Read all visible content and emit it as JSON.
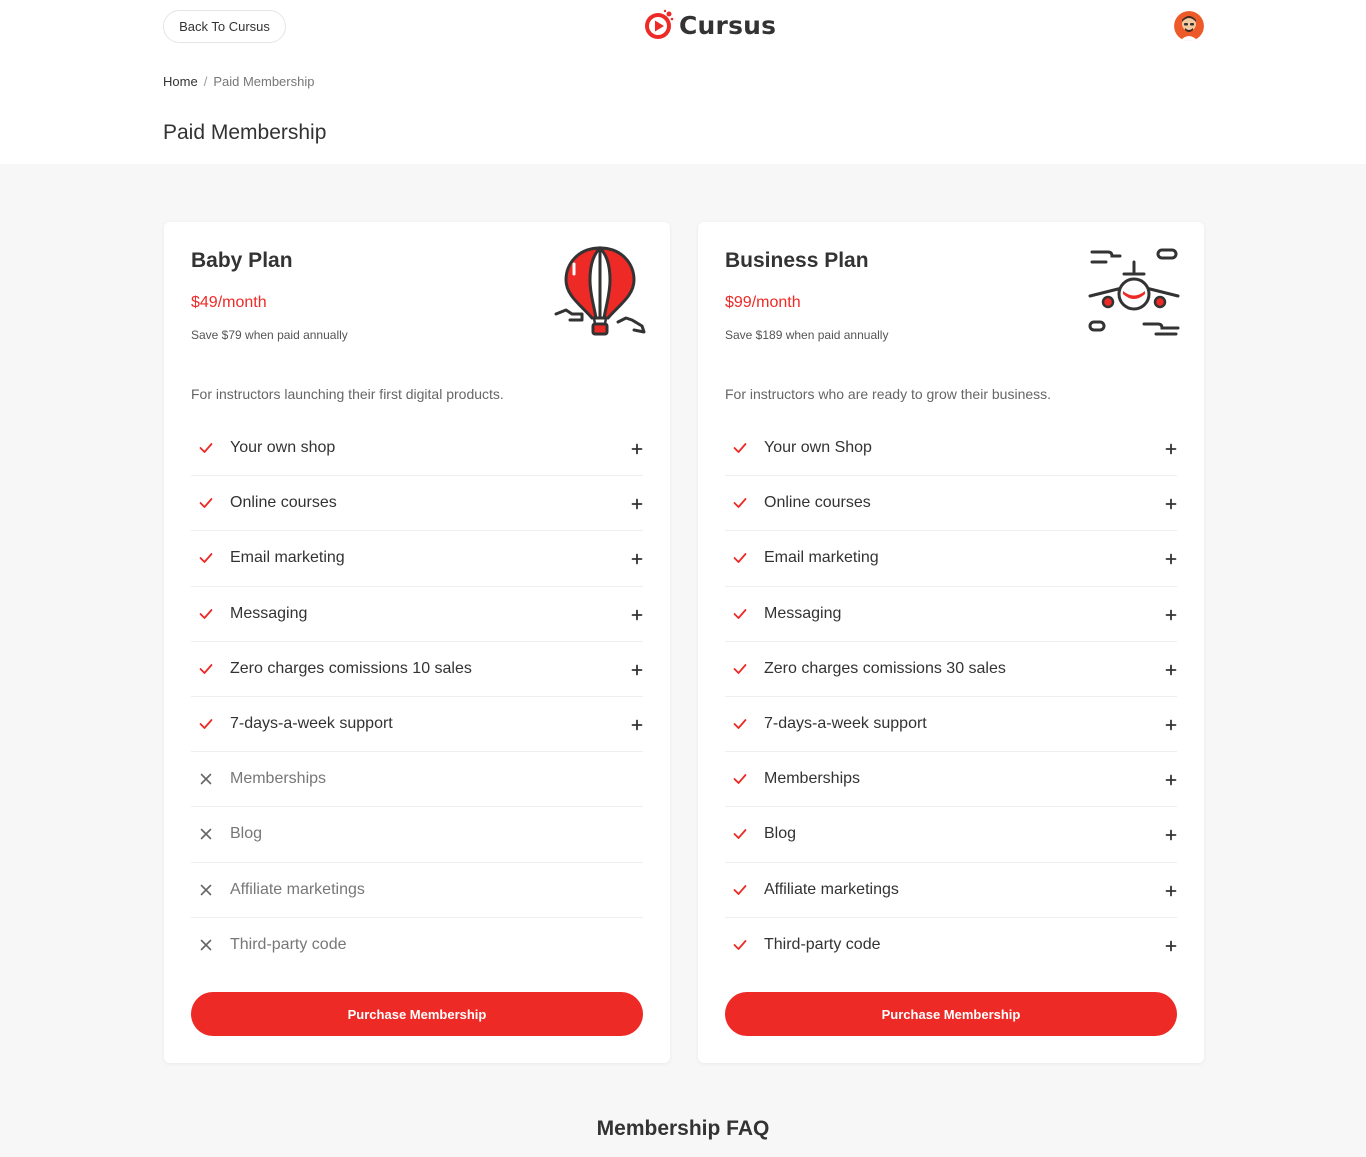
{
  "header": {
    "back_label": "Back To Cursus",
    "logo_text": "Cursus",
    "brand_color": "#ed2a26"
  },
  "breadcrumb": {
    "home": "Home",
    "separator": "/",
    "current": "Paid Membership"
  },
  "page_title": "Paid Membership",
  "plans": [
    {
      "name": "Baby Plan",
      "price": "$49/month",
      "save": "Save $79 when paid annually",
      "description": "For instructors launching their first digital products.",
      "illustration": "hot-air-balloon-icon",
      "features": [
        {
          "label": "Your own shop",
          "included": true
        },
        {
          "label": "Online courses",
          "included": true
        },
        {
          "label": "Email marketing",
          "included": true
        },
        {
          "label": "Messaging",
          "included": true
        },
        {
          "label": "Zero charges comissions 10 sales",
          "included": true
        },
        {
          "label": "7-days-a-week support",
          "included": true
        },
        {
          "label": "Memberships",
          "included": false
        },
        {
          "label": "Blog",
          "included": false
        },
        {
          "label": "Affiliate marketings",
          "included": false
        },
        {
          "label": "Third-party code",
          "included": false
        }
      ],
      "button_label": "Purchase Membership"
    },
    {
      "name": "Business Plan",
      "price": "$99/month",
      "save": "Save $189 when paid annually",
      "description": "For instructors who are ready to grow their business.",
      "illustration": "airplane-icon",
      "features": [
        {
          "label": "Your own Shop",
          "included": true
        },
        {
          "label": "Online courses",
          "included": true
        },
        {
          "label": "Email marketing",
          "included": true
        },
        {
          "label": "Messaging",
          "included": true
        },
        {
          "label": "Zero charges comissions 30 sales",
          "included": true
        },
        {
          "label": "7-days-a-week support",
          "included": true
        },
        {
          "label": "Memberships",
          "included": true
        },
        {
          "label": "Blog",
          "included": true
        },
        {
          "label": "Affiliate marketings",
          "included": true
        },
        {
          "label": "Third-party code",
          "included": true
        }
      ],
      "button_label": "Purchase Membership"
    }
  ],
  "faq_title": "Membership FAQ"
}
